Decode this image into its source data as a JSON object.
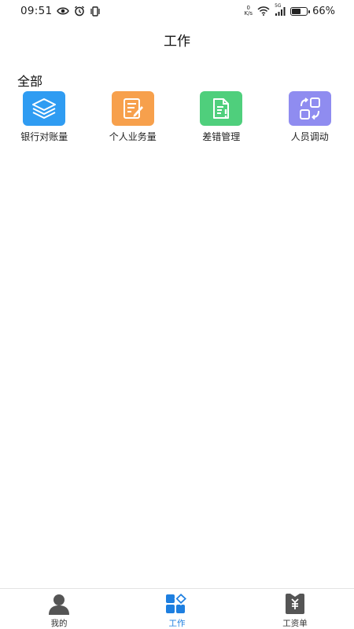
{
  "status_bar": {
    "time": "09:51",
    "net_speed_value": "0",
    "net_speed_unit": "K/s",
    "signal_label": "5G",
    "battery_percent": "66%",
    "battery_level": 0.66
  },
  "header": {
    "title": "工作"
  },
  "section": {
    "title": "全部",
    "items": [
      {
        "label": "银行对账量",
        "icon": "layers-icon",
        "color": "#2f9cf2"
      },
      {
        "label": "个人业务量",
        "icon": "edit-document-icon",
        "color": "#f7a04c"
      },
      {
        "label": "差错管理",
        "icon": "document-alert-icon",
        "color": "#4fcf7c"
      },
      {
        "label": "人员调动",
        "icon": "swap-icon",
        "color": "#8f8cf0"
      }
    ]
  },
  "bottom_nav": {
    "items": [
      {
        "label": "我的",
        "icon": "person-icon",
        "active": false
      },
      {
        "label": "工作",
        "icon": "work-grid-icon",
        "active": true
      },
      {
        "label": "工资单",
        "icon": "payslip-icon",
        "active": false
      }
    ],
    "active_color": "#1e7fe0"
  }
}
